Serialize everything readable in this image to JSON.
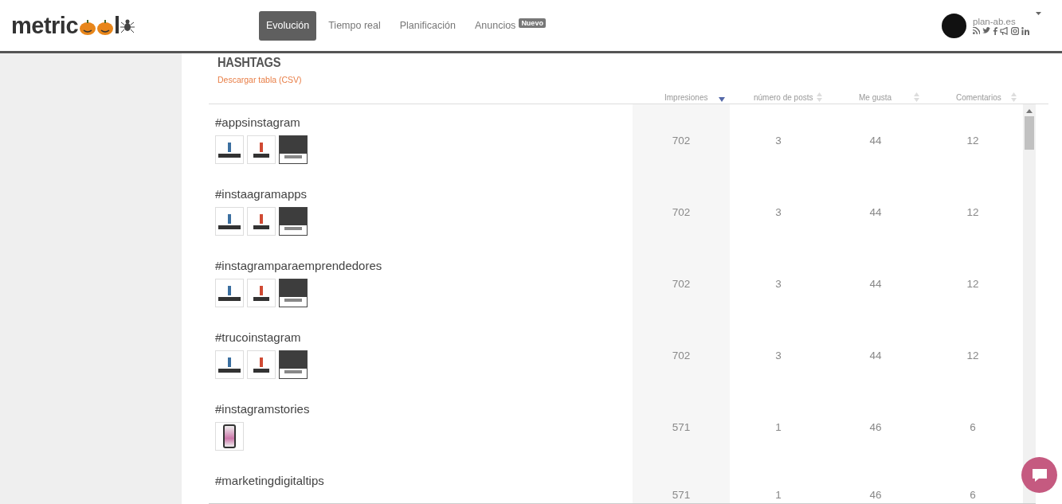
{
  "logo": {
    "text_start": "metric",
    "text_end": "l"
  },
  "nav": [
    {
      "label": "Evolución",
      "selected": true
    },
    {
      "label": "Tiempo real",
      "selected": false
    },
    {
      "label": "Planificación",
      "selected": false
    },
    {
      "label": "Anuncios",
      "selected": false,
      "badge": "Nuevo"
    }
  ],
  "account": {
    "name": "plan-ab.es",
    "networks": [
      {
        "kind": "rss"
      },
      {
        "kind": "twitter"
      },
      {
        "kind": "facebook"
      },
      {
        "kind": "ads"
      },
      {
        "kind": "instagram"
      },
      {
        "kind": "linkedin"
      }
    ]
  },
  "section": {
    "title": "HASHTAGS",
    "download_link": "Descargar tabla (CSV)"
  },
  "table": {
    "columns": [
      {
        "label": "Impresiones",
        "sorted": true
      },
      {
        "label": "número de posts",
        "sorted": false
      },
      {
        "label": "Me gusta",
        "sorted": false
      },
      {
        "label": "Comentarios",
        "sorted": false
      }
    ],
    "rows": [
      {
        "hashtag": "#appsinstagram",
        "thumbnails": [
          {
            "kind": "figure"
          },
          {
            "kind": "figure-text"
          },
          {
            "kind": "photo"
          }
        ],
        "values": [
          "702",
          "3",
          "44",
          "12"
        ]
      },
      {
        "hashtag": "#instaagramapps",
        "thumbnails": [
          {
            "kind": "figure"
          },
          {
            "kind": "figure-text"
          },
          {
            "kind": "photo"
          }
        ],
        "values": [
          "702",
          "3",
          "44",
          "12"
        ]
      },
      {
        "hashtag": "#instagramparaemprendedores",
        "thumbnails": [
          {
            "kind": "figure"
          },
          {
            "kind": "figure-text"
          },
          {
            "kind": "photo"
          }
        ],
        "values": [
          "702",
          "3",
          "44",
          "12"
        ]
      },
      {
        "hashtag": "#trucoinstagram",
        "thumbnails": [
          {
            "kind": "figure"
          },
          {
            "kind": "figure-text"
          },
          {
            "kind": "photo"
          }
        ],
        "values": [
          "702",
          "3",
          "44",
          "12"
        ]
      },
      {
        "hashtag": "#instagramstories",
        "thumbnails": [
          {
            "kind": "phone"
          }
        ],
        "values": [
          "571",
          "1",
          "46",
          "6"
        ]
      },
      {
        "hashtag": "#marketingdigitaltips",
        "thumbnails": [],
        "values": [
          "571",
          "1",
          "46",
          "6"
        ]
      }
    ]
  }
}
